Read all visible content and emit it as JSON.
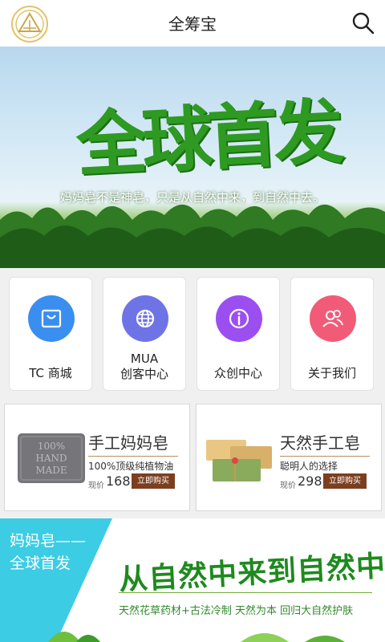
{
  "header": {
    "title": "全筹宝",
    "logo_icon": "triangle-emblem-icon",
    "search_icon": "search-icon"
  },
  "banner": {
    "headline": "全球首发",
    "subtitle": "妈妈皂不是神皂，只是从自然中来，到自然中去。"
  },
  "nav": [
    {
      "label": "TC 商城",
      "icon": "shopping-bag-icon",
      "color": "#3a8ef0"
    },
    {
      "label_line1": "MUA",
      "label_line2": "创客中心",
      "icon": "globe-icon",
      "color": "#6e74e6"
    },
    {
      "label": "众创中心",
      "icon": "info-icon",
      "color": "#9c4ff0"
    },
    {
      "label": "关于我们",
      "icon": "users-icon",
      "color": "#f25b78"
    }
  ],
  "products": [
    {
      "title": "手工妈妈皂",
      "desc": "100%顶级纯植物油",
      "price_label": "现价",
      "price": "168",
      "buy_label": "立即购买",
      "image_text": [
        "100%",
        "HAND",
        "MADE"
      ]
    },
    {
      "title": "天然手工皂",
      "desc": "聪明人的选择",
      "price_label": "现价",
      "price": "298",
      "buy_label": "立即购买"
    }
  ],
  "promo": {
    "line1": "妈妈皂——",
    "line2": "全球首发",
    "slogan": "从自然中来到自然中去",
    "slogan_sub": "天然花草药材+古法冷制 天然为本 回归大自然护肤"
  },
  "colors": {
    "brand_gold": "#e1c46b",
    "banner_green": "#2e9a22",
    "buy_brown": "#7b3f1f",
    "promo_cyan": "#3ccce4"
  }
}
